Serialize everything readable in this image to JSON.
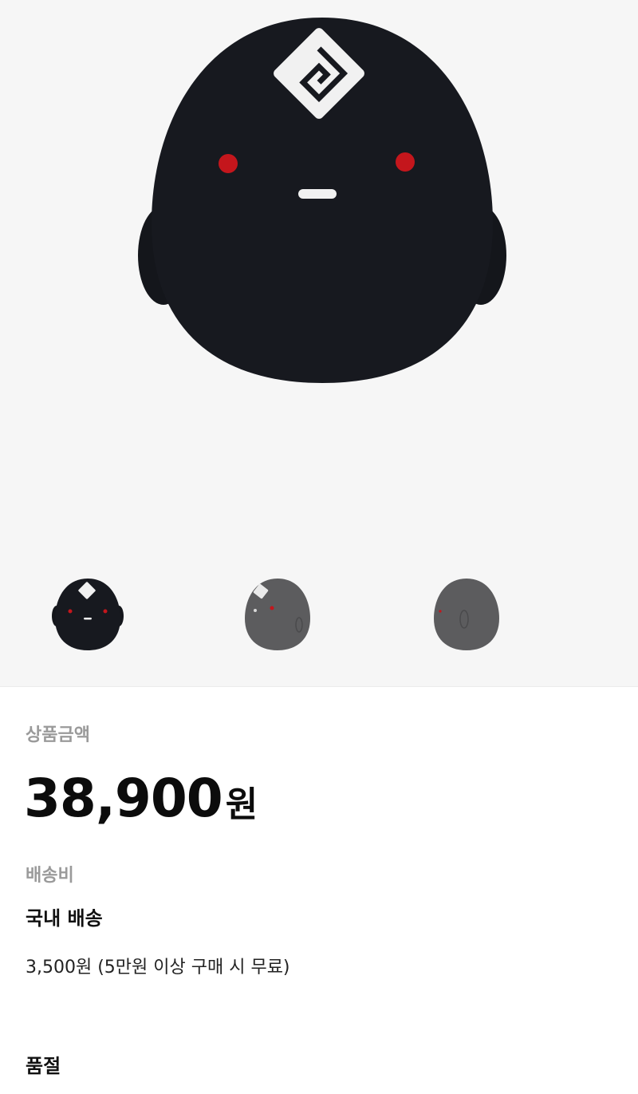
{
  "product": {
    "price_label": "상품금액",
    "price_value": "38,900",
    "price_unit": "원"
  },
  "shipping": {
    "label": "배송비",
    "type": "국내 배송",
    "fee_text": "3,500원 (5만원 이상 구매 시 무료)"
  },
  "status": {
    "text": "품절"
  },
  "colors": {
    "figure_dark": "#17191f",
    "figure_grey": "#5c5c5e",
    "eye_red": "#c4161c",
    "gallery_bg": "#f6f6f6"
  }
}
